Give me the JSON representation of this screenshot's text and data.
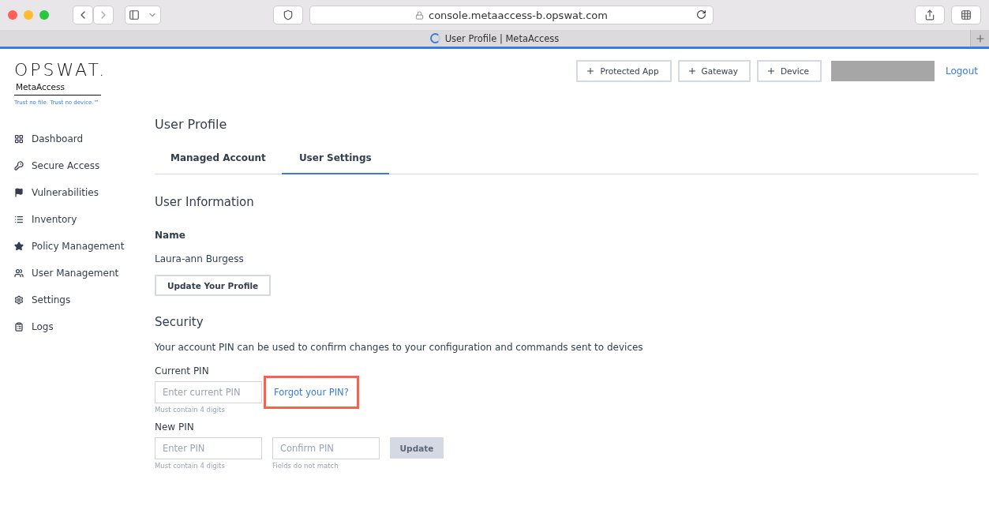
{
  "browser": {
    "url": "console.metaaccess-b.opswat.com",
    "tab_title": "User Profile | MetaAccess",
    "loading": true
  },
  "logo": {
    "brand": "OPSWAT.",
    "product": "MetaAccess",
    "tagline": "Trust no file. Trust no device.™"
  },
  "header": {
    "buttons": [
      {
        "label": "Protected App"
      },
      {
        "label": "Gateway"
      },
      {
        "label": "Device"
      }
    ],
    "logout": "Logout"
  },
  "sidebar": {
    "items": [
      {
        "label": "Dashboard",
        "selected": false
      },
      {
        "label": "Secure Access",
        "selected": false
      },
      {
        "label": "Vulnerabilities",
        "selected": false
      },
      {
        "label": "Inventory",
        "selected": false
      },
      {
        "label": "Policy Management",
        "selected": false
      },
      {
        "label": "User Management",
        "selected": false
      },
      {
        "label": "Settings",
        "selected": false
      },
      {
        "label": "Logs",
        "selected": false
      }
    ]
  },
  "page_title": "User Profile",
  "tabs": [
    {
      "label": "Managed Account",
      "selected": false
    },
    {
      "label": "User Settings",
      "selected": true
    }
  ],
  "user_information": {
    "heading": "User Information",
    "name_label": "Name",
    "name_value": "Laura-ann Burgess",
    "button": "Update Your Profile"
  },
  "security": {
    "heading": "Security",
    "description": "Your account PIN can be used to confirm changes to your configuration and commands sent to devices",
    "current_pin": {
      "label": "Current PIN",
      "placeholder": "Enter current PIN",
      "hint": "Must contain 4 digits",
      "forgot_link": "Forgot your PIN?",
      "highlighted": true
    },
    "new_pin": {
      "label": "New PIN",
      "placeholder": "Enter PIN",
      "hint": "Must contain 4 digits"
    },
    "confirm_pin": {
      "placeholder": "Confirm PIN",
      "hint": "Fields do not match"
    },
    "update_button": {
      "label": "Update",
      "disabled": true
    }
  }
}
